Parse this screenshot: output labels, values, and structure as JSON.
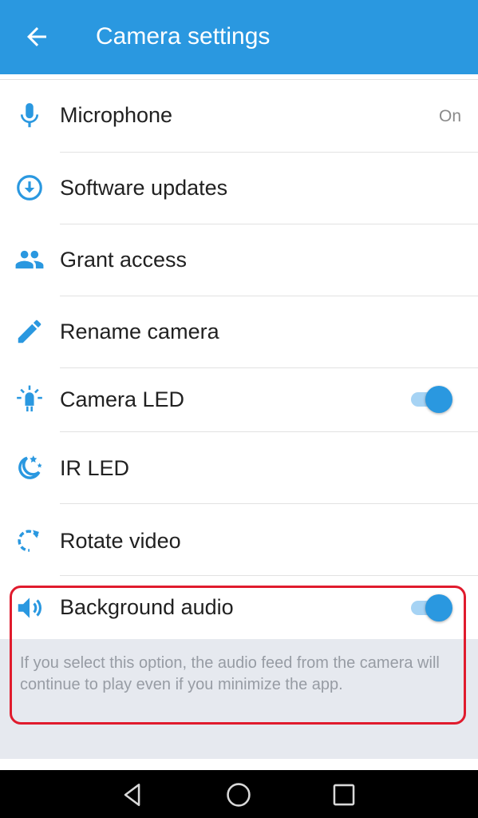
{
  "header": {
    "title": "Camera settings",
    "back_icon": "arrow-back-icon"
  },
  "accent": "#2a98e0",
  "items": [
    {
      "label": "Microphone",
      "value": "On",
      "icon": "microphone-icon"
    },
    {
      "label": "Software updates",
      "icon": "download-circle-icon"
    },
    {
      "label": "Grant access",
      "icon": "people-icon"
    },
    {
      "label": "Rename camera",
      "icon": "pencil-icon"
    },
    {
      "label": "Camera LED",
      "icon": "light-bulb-icon",
      "toggle_on": true
    },
    {
      "label": "IR LED",
      "icon": "moon-stars-icon"
    },
    {
      "label": "Rotate video",
      "icon": "rotate-icon"
    },
    {
      "label": "Background audio",
      "icon": "speaker-icon",
      "toggle_on": true
    }
  ],
  "background_audio_description": "If you select this option, the audio feed from the camera will continue to play even if you minimize the app.",
  "navbar": {
    "buttons": [
      "back-triangle-icon",
      "home-circle-icon",
      "recents-square-icon"
    ]
  }
}
